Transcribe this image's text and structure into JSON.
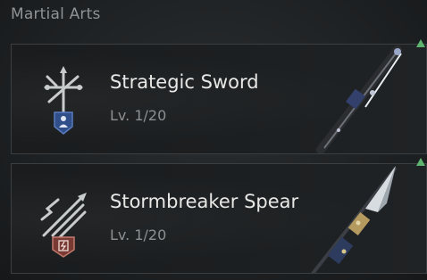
{
  "section": {
    "title": "Martial Arts"
  },
  "skills": [
    {
      "name": "Strategic Sword",
      "level": "Lv. 1/20",
      "emblem_icon": "sword-cross-icon",
      "badge_icon": "person-badge-icon",
      "weapon_icon": "sword-weapon-icon",
      "badge_color": "#2f4e8a"
    },
    {
      "name": "Stormbreaker Spear",
      "level": "Lv. 1/20",
      "emblem_icon": "lightning-spear-icon",
      "badge_icon": "lightning-badge-icon",
      "weapon_icon": "spear-weapon-icon",
      "badge_color": "#7a3a34"
    }
  ],
  "upgrade_indicator_color": "#5fb56f"
}
